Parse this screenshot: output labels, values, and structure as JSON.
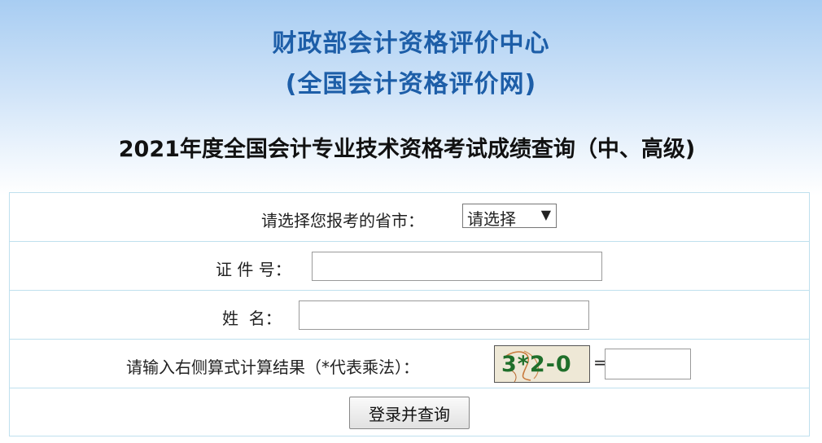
{
  "header": {
    "title_line1": "财政部会计资格评价中心",
    "title_line2": "(全国会计资格评价网)"
  },
  "page_heading": "2021年度全国会计专业技术资格考试成绩查询（中、高级)",
  "form": {
    "province_label": "请选择您报考的省市：",
    "province_select_value": "请选择",
    "id_label": "证 件 号：",
    "id_value": "",
    "name_label": "姓  名：",
    "name_value": "",
    "captcha_label": "请输入右侧算式计算结果（*代表乘法）：",
    "captcha_text": "3*2-0",
    "equals_sign": "=",
    "captcha_answer": "",
    "submit_label": "登录并查询"
  },
  "colors": {
    "title_blue": "#1d5ea8",
    "captcha_green": "#1f6f2a",
    "table_border": "#bfe0ee"
  }
}
